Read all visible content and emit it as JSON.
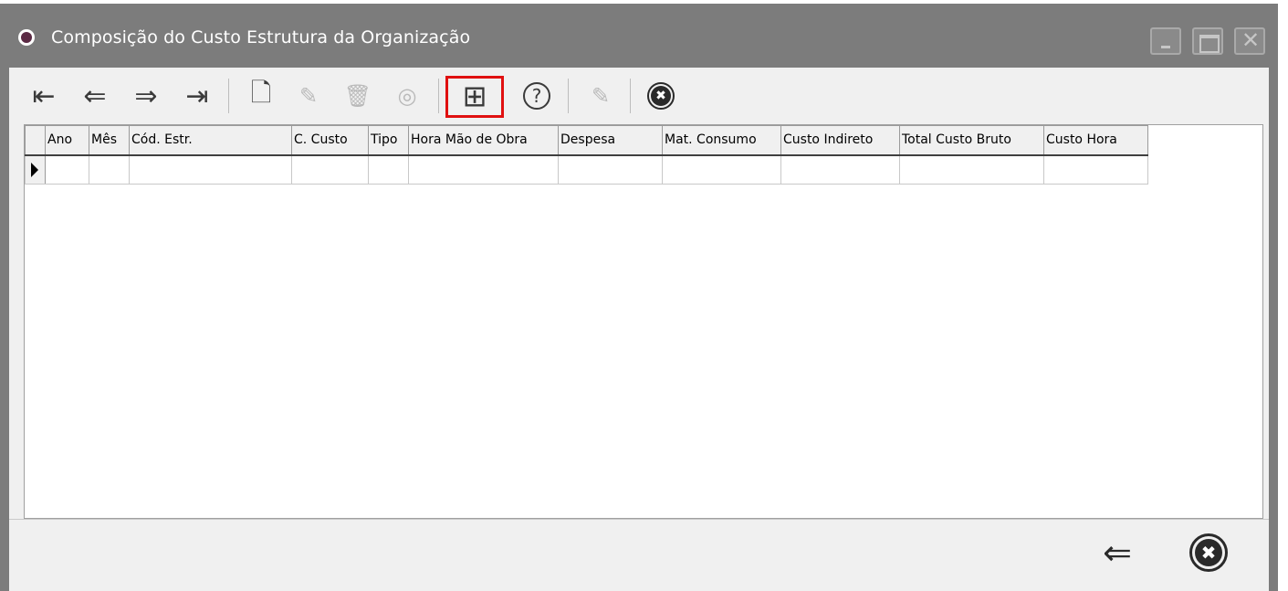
{
  "window": {
    "title": "Composição do Custo Estrutura da Organização",
    "logo_icon": "cf-logo-icon",
    "minimize_icon": "minimize-icon",
    "maximize_icon": "maximize-icon",
    "close_icon": "close-icon",
    "close_glyph": "✕"
  },
  "toolbar": {
    "first_glyph": "⇤",
    "prev_glyph": "⇐",
    "next_glyph": "⇒",
    "last_glyph": "⇥",
    "new_glyph": "🗋",
    "edit_glyph": "✎",
    "delete_glyph": "🗑",
    "view_glyph": "◎",
    "calc_glyph": "⊞",
    "help_glyph": "?",
    "annotate_glyph": "✎",
    "close_glyph": "✖",
    "highlight_color": "#e01010"
  },
  "grid": {
    "columns": [
      "Ano",
      "Mês",
      "Cód. Estr.",
      "C. Custo",
      "Tipo",
      "Hora Mão de Obra",
      "Despesa",
      "Mat. Consumo",
      "Custo Indireto",
      "Total Custo Bruto",
      "Custo Hora"
    ],
    "rows": [
      [
        "",
        "",
        "",
        "",
        "",
        "",
        "",
        "",
        "",
        "",
        ""
      ]
    ]
  },
  "footer": {
    "back_glyph": "⇐",
    "close_glyph": "✖"
  }
}
